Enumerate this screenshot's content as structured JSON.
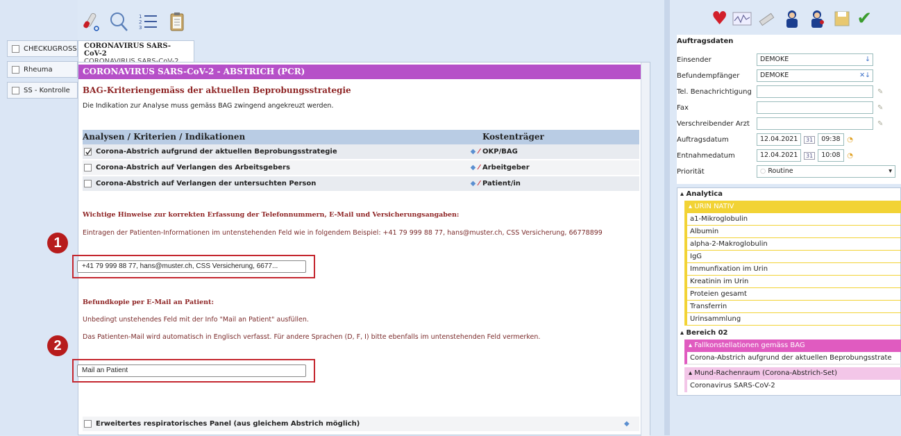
{
  "sidebar": {
    "tabs": [
      "CHECKUGROSS",
      "Rheuma",
      "SS - Kontrolle"
    ]
  },
  "center_tab": {
    "title": "CORONAVIRUS SARS-CoV-2",
    "subtitle": "CORONAVIRUS SARS-CoV-2"
  },
  "panel": {
    "header": "CORONAVIRUS SARS-CoV-2 - ABSTRICH (PCR)",
    "heading": "BAG-Kriteriengemäss der aktuellen Beprobungsstrategie",
    "intro": "Die Indikation zur Analyse muss gemäss BAG zwingend angekreuzt werden.",
    "table_header": {
      "col1": "Analysen / Kriterien / Indikationen",
      "col2": "Kostenträger"
    },
    "rows": [
      {
        "label": "Corona-Abstrich aufgrund der aktuellen Beprobungsstrategie",
        "payer": "OKP/BAG",
        "checked": true
      },
      {
        "label": "Corona-Abstrich auf Verlangen des Arbeitsgebers",
        "payer": "Arbeitgeber",
        "checked": false
      },
      {
        "label": "Corona-Abstrich auf Verlangen der untersuchten Person",
        "payer": "Patient/in",
        "checked": false
      }
    ],
    "notice_title": "Wichtige Hinweise zur korrekten Erfassung der Telefonnummern, E-Mail und Versicherungsangaben:",
    "notice_text": "Eintragen der Patienten-Informationen im untenstehenden Feld wie in folgendem Beispiel: +41 79 999 88 77, hans@muster.ch, CSS Versicherung,  66778899",
    "field1_value": "+41 79 999 88 77, hans@muster.ch, CSS Versicherung, 6677...",
    "copy_title": "Befundkopie per E-Mail an Patient:",
    "copy_text1": "Unbedingt unstehendes Feld mit der Info \"Mail an Patient\" ausfüllen.",
    "copy_text2": "Das Patienten-Mail wird automatisch in Englisch verfasst. Für andere Sprachen (D, F, I) bitte ebenfalls im untenstehenden Feld vermerken.",
    "field2_value": "Mail an Patient",
    "extended": "Erweitertes respiratorisches Panel  (aus gleichem Abstrich möglich)"
  },
  "markers": [
    "1",
    "2"
  ],
  "auftrag": {
    "title": "Auftragsdaten",
    "rows": [
      {
        "label": "Einsender",
        "value": "DEMOKE"
      },
      {
        "label": "Befundempfänger",
        "value": "DEMOKE"
      },
      {
        "label": "Tel. Benachrichtigung",
        "value": ""
      },
      {
        "label": "Fax",
        "value": ""
      },
      {
        "label": "Verschreibender Arzt",
        "value": ""
      }
    ],
    "auftragsdatum": {
      "label": "Auftragsdatum",
      "date": "12.04.2021",
      "time": "09:38"
    },
    "entnahmedatum": {
      "label": "Entnahmedatum",
      "date": "12.04.2021",
      "time": "10:08"
    },
    "prioritaet": {
      "label": "Priorität",
      "value": "Routine"
    },
    "calendar_day": "31"
  },
  "tree": {
    "group1": "Analytica",
    "sub1": "URIN NATIV",
    "items1": [
      "a1-Mikroglobulin",
      "Albumin",
      "alpha-2-Makroglobulin",
      "IgG",
      "Immunfixation im Urin",
      "Kreatinin im Urin",
      "Proteien gesamt",
      "Transferrin",
      "Urinsammlung"
    ],
    "group2": "Bereich 02",
    "sub2": "Fallkonstellationen gemäss BAG",
    "item2": "Corona-Abstrich aufgrund der aktuellen Beprobungsstrate",
    "sub3": "Mund-Rachenraum (Corona-Abstrich-Set)",
    "item3": "Coronavirus SARS-CoV-2"
  },
  "colors": {
    "header": "#b650c8",
    "yellow": "#f2d335",
    "pink": "#e05bc0",
    "lightpink": "#f3c6e8",
    "red": "#c4262e"
  }
}
